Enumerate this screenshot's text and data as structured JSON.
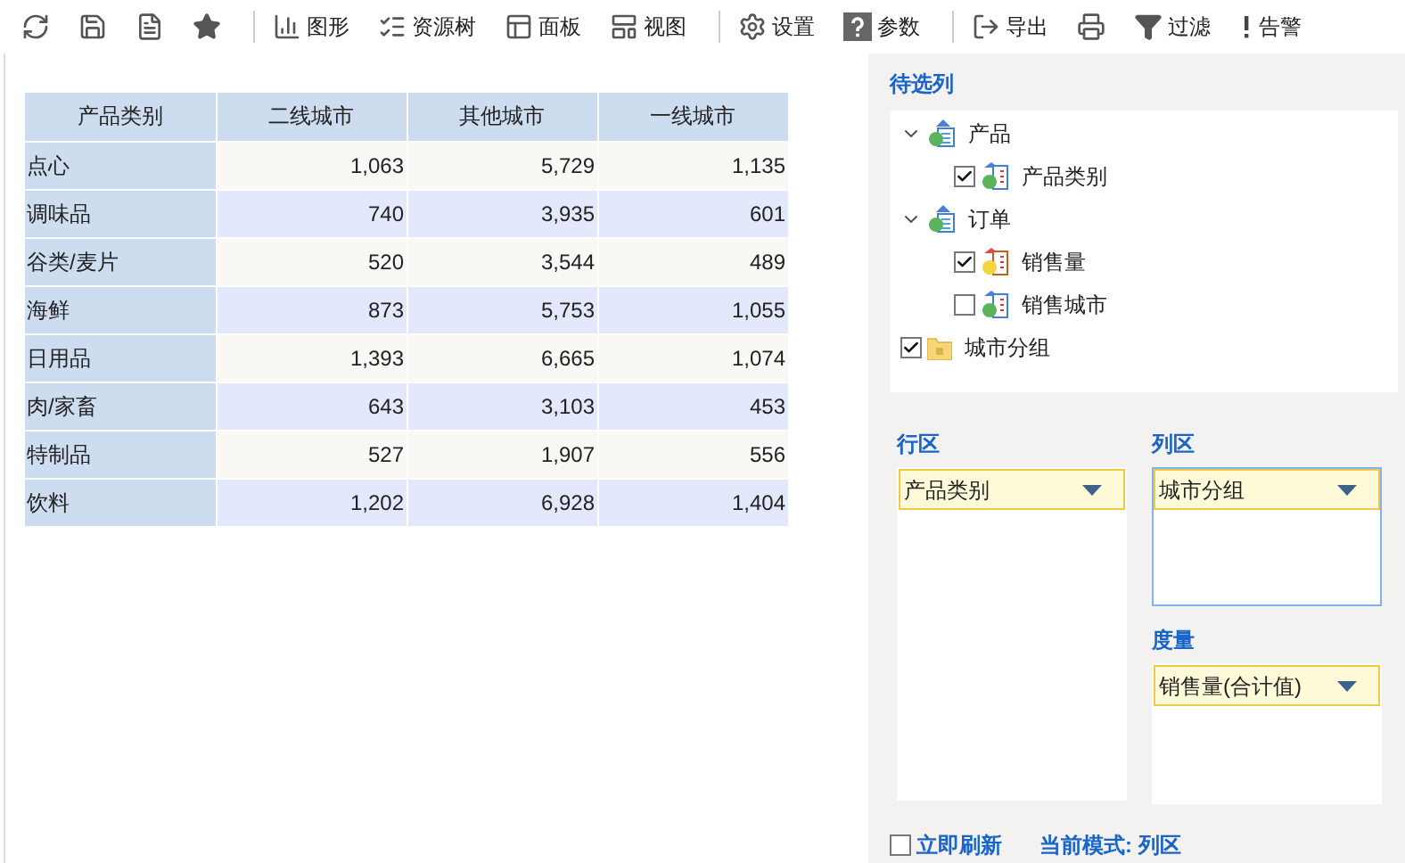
{
  "toolbar": [
    [
      {
        "kind": "icon"
      },
      {
        "kind": "icon"
      },
      {
        "kind": "icon"
      },
      {
        "kind": "icon"
      }
    ],
    [
      {
        "label": "图形"
      },
      {
        "label": "资源树"
      },
      {
        "label": "面板"
      },
      {
        "label": "视图"
      }
    ],
    [
      {
        "label": "设置"
      },
      {
        "label": "参数"
      }
    ],
    [
      {
        "label": "导出"
      },
      {
        "kind": "icon"
      },
      {
        "label": "过滤"
      },
      {
        "label": "告警"
      }
    ]
  ],
  "table": {
    "columns": [
      "产品类别",
      "二线城市",
      "其他城市",
      "一线城市"
    ],
    "rows": [
      [
        "点心",
        "1,063",
        "5,729",
        "1,135"
      ],
      [
        "调味品",
        "740",
        "3,935",
        "601"
      ],
      [
        "谷类/麦片",
        "520",
        "3,544",
        "489"
      ],
      [
        "海鲜",
        "873",
        "5,753",
        "1,055"
      ],
      [
        "日用品",
        "1,393",
        "6,665",
        "1,074"
      ],
      [
        "肉/家畜",
        "643",
        "3,103",
        "453"
      ],
      [
        "特制品",
        "527",
        "1,907",
        "556"
      ],
      [
        "饮料",
        "1,202",
        "6,928",
        "1,404"
      ]
    ]
  },
  "candidates": {
    "title": "待选列",
    "tree": [
      {
        "kind": "table",
        "label": "产品",
        "expanded": true,
        "children": [
          {
            "kind": "dimension",
            "label": "产品类别",
            "checked": true
          }
        ]
      },
      {
        "kind": "table",
        "label": "订单",
        "expanded": true,
        "children": [
          {
            "kind": "measure",
            "label": "销售量",
            "checked": true
          },
          {
            "kind": "dimension",
            "label": "销售城市",
            "checked": false
          }
        ]
      },
      {
        "kind": "folder",
        "label": "城市分组",
        "checked": true
      }
    ]
  },
  "zones": [
    {
      "title": "行区",
      "focused": false,
      "items": [
        {
          "label": "产品类别"
        }
      ]
    },
    {
      "title": "列区",
      "focused": true,
      "items": [
        {
          "label": "城市分组"
        }
      ]
    },
    {
      "title": "度量",
      "focused": false,
      "items": [
        {
          "label": "销售量(合计值)"
        }
      ]
    }
  ],
  "footer": {
    "refresh_label": "立即刷新",
    "refresh_checked": false,
    "mode": "当前模式: 列区"
  }
}
